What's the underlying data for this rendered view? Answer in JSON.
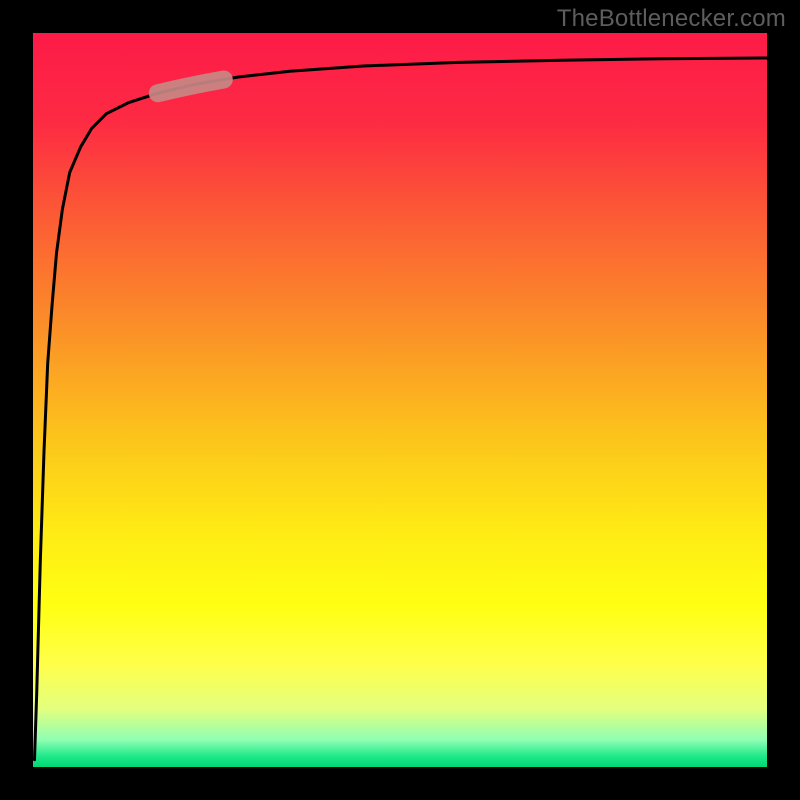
{
  "source_label": "TheBottlenecker.com",
  "colors": {
    "bg_black": "#000000",
    "gradient_stops": [
      {
        "offset": 0.0,
        "color": "#fd1b48"
      },
      {
        "offset": 0.12,
        "color": "#fd2a43"
      },
      {
        "offset": 0.25,
        "color": "#fc5b35"
      },
      {
        "offset": 0.4,
        "color": "#fb8f28"
      },
      {
        "offset": 0.55,
        "color": "#fcc41b"
      },
      {
        "offset": 0.68,
        "color": "#feeb14"
      },
      {
        "offset": 0.78,
        "color": "#ffff12"
      },
      {
        "offset": 0.86,
        "color": "#ffff4a"
      },
      {
        "offset": 0.92,
        "color": "#e4ff7e"
      },
      {
        "offset": 0.963,
        "color": "#8fffb3"
      },
      {
        "offset": 0.985,
        "color": "#20e989"
      },
      {
        "offset": 1.0,
        "color": "#00d775"
      }
    ],
    "curve": "#000000",
    "highlight_fill": "#c78884",
    "highlight_stroke": "#c78884"
  },
  "chart_data": {
    "type": "line",
    "title": "",
    "xlabel": "",
    "ylabel": "",
    "xlim": [
      0,
      100
    ],
    "ylim": [
      0,
      100
    ],
    "grid": false,
    "legend": false,
    "note": "Axes are unlabeled in source. Curve is a bottleneck-style log-like curve: steep near x≈0 rising from y≈0, asymptoting toward y≈100 as x→100. Values estimated from pixel positions (plot area normalized 0–100).",
    "series": [
      {
        "name": "curve",
        "x": [
          0.2,
          0.5,
          1,
          1.5,
          2,
          2.6,
          3.2,
          4,
          5,
          6.5,
          8,
          10,
          13,
          17,
          22,
          28,
          35,
          45,
          58,
          72,
          86,
          100
        ],
        "y": [
          1,
          10,
          28,
          43,
          55,
          63,
          70,
          76,
          81,
          84.5,
          87,
          89,
          90.5,
          91.8,
          93,
          94,
          94.8,
          95.5,
          96,
          96.3,
          96.5,
          96.6
        ]
      }
    ],
    "highlight": {
      "description": "Thick rounded segment overlaid on curve",
      "x_range": [
        17,
        26
      ],
      "y_range": [
        88.5,
        91.6
      ]
    }
  }
}
